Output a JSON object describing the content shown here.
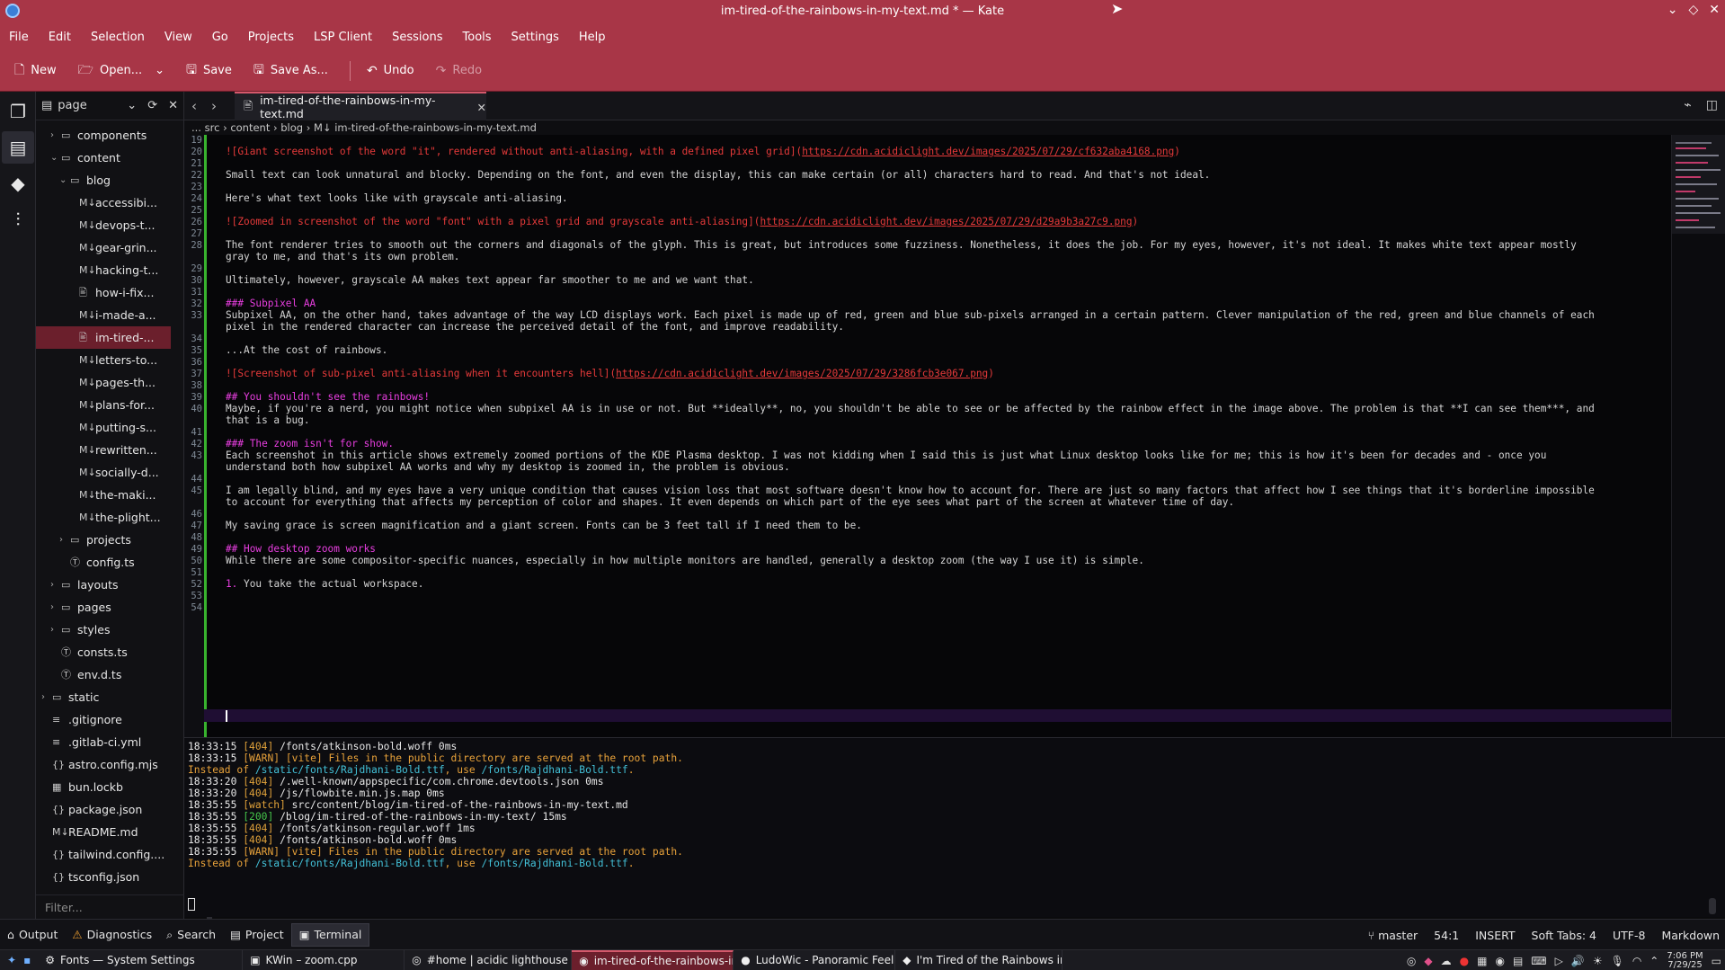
{
  "window": {
    "title": "im-tired-of-the-rainbows-in-my-text.md * — Kate"
  },
  "menu": [
    "File",
    "Edit",
    "Selection",
    "View",
    "Go",
    "Projects",
    "LSP Client",
    "Sessions",
    "Tools",
    "Settings",
    "Help"
  ],
  "toolbar": {
    "new": "New",
    "open": "Open...",
    "save": "Save",
    "save_as": "Save As...",
    "undo": "Undo",
    "redo": "Redo"
  },
  "sidebar": {
    "title": "page",
    "filter_placeholder": "Filter..."
  },
  "filetree": [
    {
      "name": "components",
      "depth": 0,
      "type": "folder",
      "arrow": "›"
    },
    {
      "name": "content",
      "depth": 0,
      "type": "folder",
      "arrow": "⌄"
    },
    {
      "name": "blog",
      "depth": 1,
      "type": "folder",
      "arrow": "⌄"
    },
    {
      "name": "accessibi...",
      "depth": 2,
      "type": "md"
    },
    {
      "name": "devops-t...",
      "depth": 2,
      "type": "md"
    },
    {
      "name": "gear-grin...",
      "depth": 2,
      "type": "md"
    },
    {
      "name": "hacking-t...",
      "depth": 2,
      "type": "md"
    },
    {
      "name": "how-i-fix...",
      "depth": 2,
      "type": "doc"
    },
    {
      "name": "i-made-a...",
      "depth": 2,
      "type": "md"
    },
    {
      "name": "im-tired-...",
      "depth": 2,
      "type": "doc",
      "selected": true
    },
    {
      "name": "letters-to...",
      "depth": 2,
      "type": "md"
    },
    {
      "name": "pages-th...",
      "depth": 2,
      "type": "md"
    },
    {
      "name": "plans-for...",
      "depth": 2,
      "type": "md"
    },
    {
      "name": "putting-s...",
      "depth": 2,
      "type": "md"
    },
    {
      "name": "rewritten...",
      "depth": 2,
      "type": "md"
    },
    {
      "name": "socially-d...",
      "depth": 2,
      "type": "md"
    },
    {
      "name": "the-maki...",
      "depth": 2,
      "type": "md"
    },
    {
      "name": "the-plight...",
      "depth": 2,
      "type": "md"
    },
    {
      "name": "projects",
      "depth": 1,
      "type": "folder",
      "arrow": "›"
    },
    {
      "name": "config.ts",
      "depth": 1,
      "type": "ts"
    },
    {
      "name": "layouts",
      "depth": 0,
      "type": "folder",
      "arrow": "›"
    },
    {
      "name": "pages",
      "depth": 0,
      "type": "folder",
      "arrow": "›"
    },
    {
      "name": "styles",
      "depth": 0,
      "type": "folder",
      "arrow": "›"
    },
    {
      "name": "consts.ts",
      "depth": 0,
      "type": "ts"
    },
    {
      "name": "env.d.ts",
      "depth": 0,
      "type": "ts"
    },
    {
      "name": "static",
      "depth": -1,
      "type": "folder",
      "arrow": "›"
    },
    {
      "name": ".gitignore",
      "depth": -1,
      "type": "file"
    },
    {
      "name": ".gitlab-ci.yml",
      "depth": -1,
      "type": "file"
    },
    {
      "name": "astro.config.mjs",
      "depth": -1,
      "type": "code"
    },
    {
      "name": "bun.lockb",
      "depth": -1,
      "type": "bin"
    },
    {
      "name": "package.json",
      "depth": -1,
      "type": "code"
    },
    {
      "name": "README.md",
      "depth": -1,
      "type": "md"
    },
    {
      "name": "tailwind.config....",
      "depth": -1,
      "type": "code"
    },
    {
      "name": "tsconfig.json",
      "depth": -1,
      "type": "code"
    }
  ],
  "tab": {
    "label": "im-tired-of-the-rainbows-in-my-text.md"
  },
  "breadcrumb": {
    "text": "... src  ›  content  ›  blog  ›  M↓  im-tired-of-the-rainbows-in-my-text.md"
  },
  "editor_lines": [
    {
      "n": "19",
      "segments": []
    },
    {
      "n": "20",
      "cls": "lk",
      "segments": [
        {
          "t": "![Giant screenshot of the word \"it\", rendered without anti-aliasing, with a defined pixel grid]("
        },
        {
          "t": "https://cdn.acidiclight.dev/images/2025/07/29/cf632aba4168.png",
          "u": true
        },
        {
          "t": ")"
        }
      ]
    },
    {
      "n": "21",
      "segments": []
    },
    {
      "n": "22",
      "segments": [
        {
          "t": "Small text can look unnatural and blocky. Depending on the font, and even the display, this can make certain (or all) characters hard to read. And that's not ideal."
        }
      ]
    },
    {
      "n": "23",
      "segments": []
    },
    {
      "n": "24",
      "segments": [
        {
          "t": "Here's what text looks like with grayscale anti-aliasing."
        }
      ]
    },
    {
      "n": "25",
      "segments": []
    },
    {
      "n": "26",
      "cls": "lk",
      "segments": [
        {
          "t": "![Zoomed in screenshot of the word \"font\" with a pixel grid and grayscale anti-aliasing]("
        },
        {
          "t": "https://cdn.acidiclight.dev/images/2025/07/29/d29a9b3a27c9.png",
          "u": true
        },
        {
          "t": ")"
        }
      ]
    },
    {
      "n": "27",
      "segments": []
    },
    {
      "n": "28",
      "segments": [
        {
          "t": "The font renderer tries to smooth out the corners and diagonals of the glyph. This is great, but introduces some fuzziness. Nonetheless, it does the job. For my eyes, however, it's not ideal. It makes white text appear mostly"
        }
      ]
    },
    {
      "n": "",
      "segments": [
        {
          "t": "gray to me, and that's its own problem."
        }
      ]
    },
    {
      "n": "29",
      "segments": []
    },
    {
      "n": "30",
      "segments": [
        {
          "t": "Ultimately, however, grayscale AA makes text appear far smoother to me and we want that."
        }
      ]
    },
    {
      "n": "31",
      "segments": []
    },
    {
      "n": "32",
      "cls": "hd",
      "segments": [
        {
          "t": "### Subpixel AA"
        }
      ]
    },
    {
      "n": "33",
      "segments": [
        {
          "t": "Subpixel AA, on the other hand, takes advantage of the way LCD displays work. Each pixel is made up of red, green and blue sub-pixels arranged in a certain pattern. Clever manipulation of the red, green and blue channels of each"
        }
      ]
    },
    {
      "n": "",
      "segments": [
        {
          "t": "pixel in the rendered character can increase the perceived detail of the font, and improve readability."
        }
      ]
    },
    {
      "n": "34",
      "segments": []
    },
    {
      "n": "35",
      "segments": [
        {
          "t": "...At the cost of rainbows."
        }
      ]
    },
    {
      "n": "36",
      "segments": []
    },
    {
      "n": "37",
      "cls": "lk",
      "segments": [
        {
          "t": "![Screenshot of sub-pixel anti-aliasing when it encounters hell]("
        },
        {
          "t": "https://cdn.acidiclight.dev/images/2025/07/29/3286fcb3e067.png",
          "u": true
        },
        {
          "t": ")"
        }
      ]
    },
    {
      "n": "38",
      "segments": []
    },
    {
      "n": "39",
      "cls": "hd",
      "segments": [
        {
          "t": "## You shouldn't see the rainbows!"
        }
      ]
    },
    {
      "n": "40",
      "segments": [
        {
          "t": "Maybe, if you're a nerd, you might notice when subpixel AA is in use or not. But **ideally**, no, you shouldn't be able to see or be affected by the rainbow effect in the image above. The problem is that **I can see them***, and"
        }
      ]
    },
    {
      "n": "",
      "segments": [
        {
          "t": "that is a bug."
        }
      ]
    },
    {
      "n": "41",
      "segments": []
    },
    {
      "n": "42",
      "cls": "hd",
      "segments": [
        {
          "t": "### The zoom isn't for show."
        }
      ]
    },
    {
      "n": "43",
      "segments": [
        {
          "t": "Each screenshot in this article shows extremely zoomed portions of the KDE Plasma desktop. I was not kidding when I said this is just what Linux desktop looks like for me; this is how it's been for decades and - once you"
        }
      ]
    },
    {
      "n": "",
      "segments": [
        {
          "t": "understand both how subpixel AA works and why my desktop is zoomed in, the problem is obvious."
        }
      ]
    },
    {
      "n": "44",
      "segments": []
    },
    {
      "n": "45",
      "segments": [
        {
          "t": "I am legally blind, and my eyes have a very unique condition that causes vision loss that most software doesn't know how to account for. There are just so many factors that affect how I see things that it's borderline impossible"
        }
      ]
    },
    {
      "n": "",
      "segments": [
        {
          "t": "to account for everything that affects my perception of color and shapes. It even depends on which part of the eye sees what part of the screen at whatever time of day."
        }
      ]
    },
    {
      "n": "46",
      "segments": []
    },
    {
      "n": "47",
      "segments": [
        {
          "t": "My saving grace is screen magnification and a giant screen. Fonts can be 3 feet tall if I need them to be."
        }
      ]
    },
    {
      "n": "48",
      "segments": []
    },
    {
      "n": "49",
      "cls": "hd",
      "segments": [
        {
          "t": "## How desktop zoom works"
        }
      ]
    },
    {
      "n": "50",
      "segments": [
        {
          "t": "While there are some compositor-specific nuances, especially in how multiple monitors are handled, generally a desktop zoom (the way I use it) is simple."
        }
      ]
    },
    {
      "n": "51",
      "segments": []
    },
    {
      "n": "52",
      "cls": "bl",
      "segments": [
        {
          "t": "1. "
        },
        {
          "t": "You take the actual workspace.",
          "plain": true
        }
      ]
    },
    {
      "n": "53",
      "segments": []
    },
    {
      "n": "54",
      "segments": []
    }
  ],
  "terminal": [
    {
      "kind": "log",
      "ts": "18:33:15",
      "status": "[404]",
      "scls": "s4",
      "path": "/fonts/atkinson-bold.woff 0ms"
    },
    {
      "kind": "warn",
      "ts": "18:33:15",
      "status": "[WARN]",
      "path": "[vite] Files in the public directory are served at the root path."
    },
    {
      "kind": "warn2",
      "pre": "Instead of ",
      "a": "/static/fonts/Rajdhani-Bold.ttf",
      "mid": ", use ",
      "b": "/fonts/Rajdhani-Bold.ttf",
      "post": "."
    },
    {
      "kind": "log",
      "ts": "18:33:20",
      "status": "[404]",
      "scls": "s4",
      "path": "/.well-known/appspecific/com.chrome.devtools.json 0ms"
    },
    {
      "kind": "log",
      "ts": "18:33:20",
      "status": "[404]",
      "scls": "s4",
      "path": "/js/flowbite.min.js.map 0ms"
    },
    {
      "kind": "log",
      "ts": "18:35:55",
      "status": "[watch]",
      "scls": "sw",
      "path": "src/content/blog/im-tired-of-the-rainbows-in-my-text.md"
    },
    {
      "kind": "log",
      "ts": "18:35:55",
      "status": "[200]",
      "scls": "s2",
      "path": "/blog/im-tired-of-the-rainbows-in-my-text/ 15ms"
    },
    {
      "kind": "log",
      "ts": "18:35:55",
      "status": "[404]",
      "scls": "s4",
      "path": "/fonts/atkinson-regular.woff 1ms"
    },
    {
      "kind": "log",
      "ts": "18:35:55",
      "status": "[404]",
      "scls": "s4",
      "path": "/fonts/atkinson-bold.woff 0ms"
    },
    {
      "kind": "warn",
      "ts": "18:35:55",
      "status": "[WARN]",
      "path": "[vite] Files in the public directory are served at the root path."
    },
    {
      "kind": "warn2",
      "pre": "Instead of ",
      "a": "/static/fonts/Rajdhani-Bold.ttf",
      "mid": ", use ",
      "b": "/fonts/Rajdhani-Bold.ttf",
      "post": "."
    }
  ],
  "bottom_tabs": [
    {
      "label": "Output",
      "icon": "⌂"
    },
    {
      "label": "Diagnostics",
      "icon": "⚠"
    },
    {
      "label": "Search",
      "icon": "⌕"
    },
    {
      "label": "Project",
      "icon": "▤"
    },
    {
      "label": "Terminal",
      "icon": "▣",
      "active": true
    }
  ],
  "status": {
    "branch": "master",
    "position": "54:1",
    "mode": "INSERT",
    "tabs": "Soft Tabs: 4",
    "encoding": "UTF-8",
    "language": "Markdown"
  },
  "taskbar": [
    {
      "label": "Fonts — System Settings",
      "icon": "⚙",
      "w": 228
    },
    {
      "label": "KWin – zoom.cpp",
      "icon": "▣",
      "w": 180
    },
    {
      "label": "#home | acidic lighthouse - Dis...",
      "icon": "◎",
      "w": 186
    },
    {
      "label": "im-tired-of-the-rainbows-in-my-t...",
      "icon": "◉",
      "w": 180,
      "active": true
    },
    {
      "label": "LudoWic - Panoramic Feelings",
      "icon": "●",
      "w": 180
    },
    {
      "label": "I'm Tired of the Rainbows in my ...",
      "icon": "◆",
      "w": 186
    }
  ],
  "clock": {
    "time": "7:06 PM",
    "date": "7/29/25"
  },
  "colors": {
    "accent": "#a83647",
    "selection": "#6b1f2c",
    "link": "#e63a3a",
    "heading": "#e83ee0",
    "diff": "#38b22e"
  }
}
